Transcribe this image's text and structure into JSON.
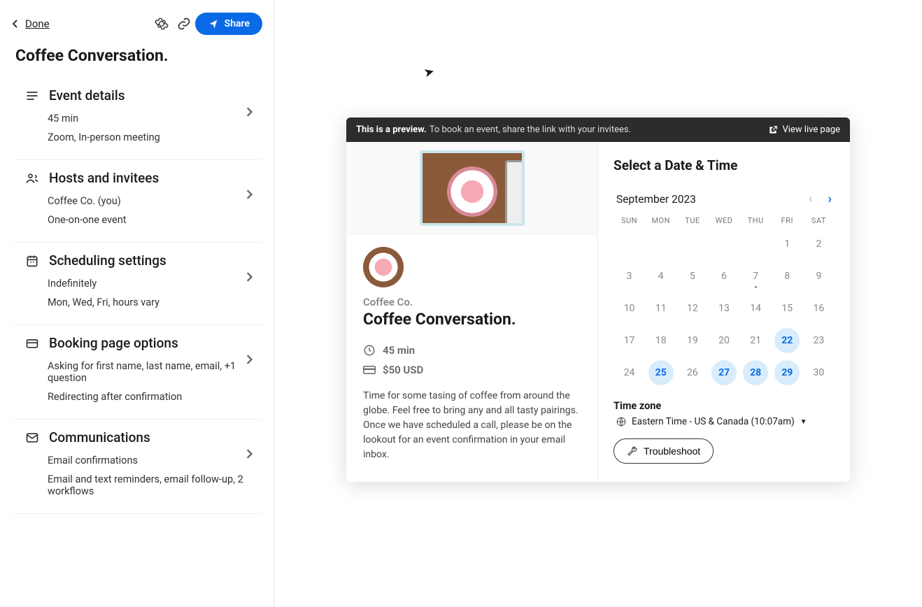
{
  "topbar": {
    "done": "Done",
    "share": "Share"
  },
  "title": "Coffee Conversation.",
  "sections": [
    {
      "heading": "Event details",
      "lines": [
        "45 min",
        "Zoom, In-person meeting"
      ]
    },
    {
      "heading": "Hosts and invitees",
      "lines": [
        "Coffee Co. (you)",
        "One-on-one event"
      ]
    },
    {
      "heading": "Scheduling settings",
      "lines": [
        "Indefinitely",
        "Mon, Wed, Fri, hours vary"
      ]
    },
    {
      "heading": "Booking page options",
      "lines": [
        "Asking for first name, last name, email, +1 question",
        "Redirecting after confirmation"
      ]
    },
    {
      "heading": "Communications",
      "lines": [
        "Email confirmations",
        "Email and text reminders, email follow-up, 2 workflows"
      ]
    }
  ],
  "preview": {
    "banner_bold": "This is a preview.",
    "banner_text": "To book an event, share the link with your invitees.",
    "view_live": "View live page",
    "host": "Coffee Co.",
    "event": "Coffee Conversation.",
    "duration": "45 min",
    "price": "$50 USD",
    "description": "Time for some tasing of coffee from around the globe. Feel free to bring any and all tasty pairings. Once we have scheduled a call, please be on the lookout for an event confirmation in your email inbox."
  },
  "calendar": {
    "title": "Select a Date & Time",
    "month": "September 2023",
    "dow": [
      "SUN",
      "MON",
      "TUE",
      "WED",
      "THU",
      "FRI",
      "SAT"
    ],
    "weeks": [
      [
        {
          "n": ""
        },
        {
          "n": ""
        },
        {
          "n": ""
        },
        {
          "n": ""
        },
        {
          "n": ""
        },
        {
          "n": "1"
        },
        {
          "n": "2"
        }
      ],
      [
        {
          "n": "3"
        },
        {
          "n": "4"
        },
        {
          "n": "5"
        },
        {
          "n": "6"
        },
        {
          "n": "7",
          "dot": true
        },
        {
          "n": "8"
        },
        {
          "n": "9"
        }
      ],
      [
        {
          "n": "10"
        },
        {
          "n": "11"
        },
        {
          "n": "12"
        },
        {
          "n": "13"
        },
        {
          "n": "14"
        },
        {
          "n": "15"
        },
        {
          "n": "16"
        }
      ],
      [
        {
          "n": "17"
        },
        {
          "n": "18"
        },
        {
          "n": "19"
        },
        {
          "n": "20"
        },
        {
          "n": "21"
        },
        {
          "n": "22",
          "avail": true
        },
        {
          "n": "23"
        }
      ],
      [
        {
          "n": "24"
        },
        {
          "n": "25",
          "avail": true
        },
        {
          "n": "26"
        },
        {
          "n": "27",
          "avail": true
        },
        {
          "n": "28",
          "avail": true
        },
        {
          "n": "29",
          "avail": true
        },
        {
          "n": "30"
        }
      ]
    ],
    "tz_label": "Time zone",
    "tz_value": "Eastern Time - US & Canada (10:07am)",
    "troubleshoot": "Troubleshoot"
  }
}
